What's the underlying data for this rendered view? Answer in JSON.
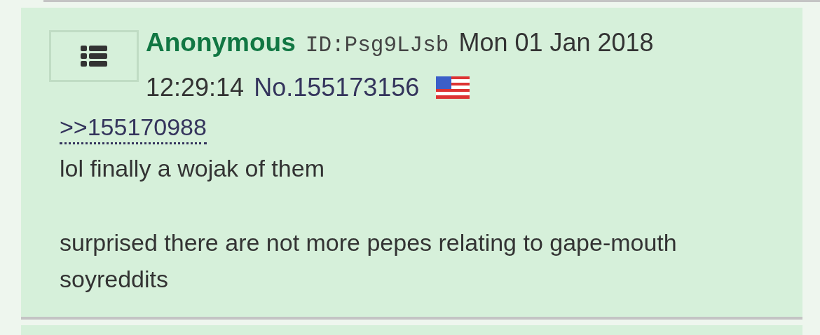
{
  "post": {
    "name": "Anonymous",
    "poster_id": "ID:Psg9LJsb",
    "date": "Mon 01 Jan 2018",
    "time": "12:29:14",
    "number": "No.155173156",
    "quote_link": ">>155170988",
    "body": [
      "lol finally a wojak of them",
      "surprised there are not more pepes relating to gape-mouth soyreddits"
    ]
  }
}
